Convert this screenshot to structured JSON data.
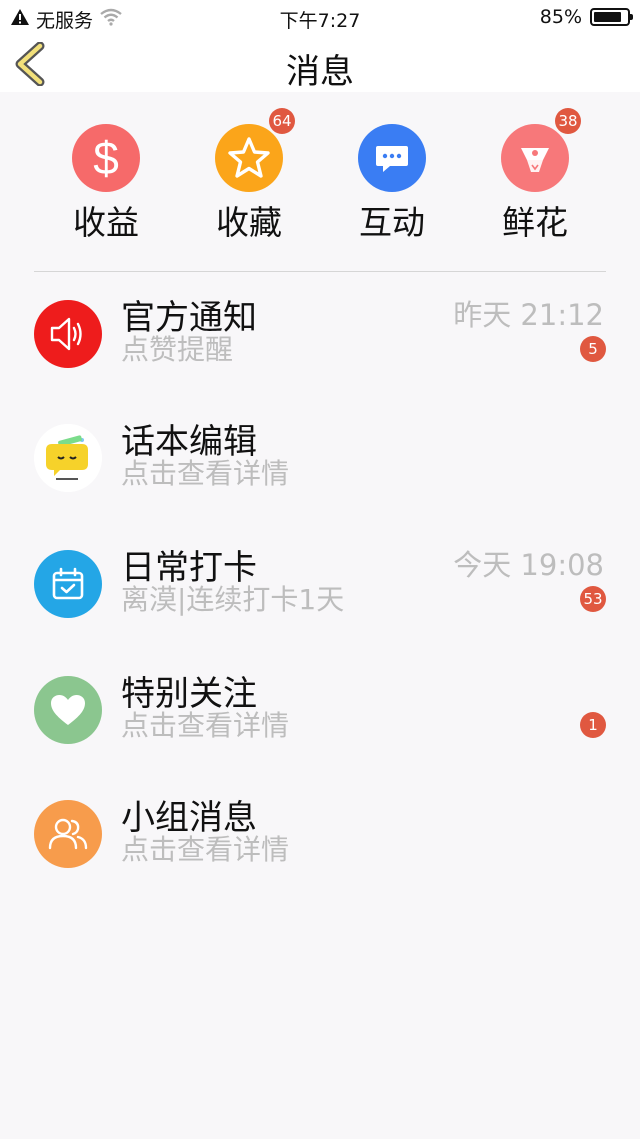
{
  "status_bar": {
    "carrier": "无服务",
    "time": "下午7:27",
    "battery": "85%",
    "battery_level": 0.85
  },
  "nav": {
    "title": "消息"
  },
  "categories": [
    {
      "label": "收益",
      "color": "#f66a6a",
      "icon": "dollar-icon",
      "badge": null
    },
    {
      "label": "收藏",
      "color": "#fba51a",
      "icon": "star-icon",
      "badge": "64"
    },
    {
      "label": "互动",
      "color": "#3a7df3",
      "icon": "chat-bubble-icon",
      "badge": null
    },
    {
      "label": "鲜花",
      "color": "#f7787a",
      "icon": "flower-bouquet-icon",
      "badge": "38"
    }
  ],
  "messages": [
    {
      "title": "官方通知",
      "subtitle": "点赞提醒",
      "time": "昨天 21:12",
      "badge": "5",
      "color": "#ee1c1c",
      "icon": "speaker-icon"
    },
    {
      "title": "话本编辑",
      "subtitle": "点击查看详情",
      "time": "",
      "badge": "",
      "color": "#ffffff",
      "icon": "editor-avatar-icon"
    },
    {
      "title": "日常打卡",
      "subtitle": "离漠|连续打卡1天",
      "time": "今天 19:08",
      "badge": "53",
      "color": "#24a6e6",
      "icon": "calendar-check-icon"
    },
    {
      "title": "特别关注",
      "subtitle": "点击查看详情",
      "time": "",
      "badge": "1",
      "color": "#8bc68f",
      "icon": "heart-icon"
    },
    {
      "title": "小组消息",
      "subtitle": "点击查看详情",
      "time": "",
      "badge": "",
      "color": "#f79c4c",
      "icon": "group-icon"
    }
  ]
}
